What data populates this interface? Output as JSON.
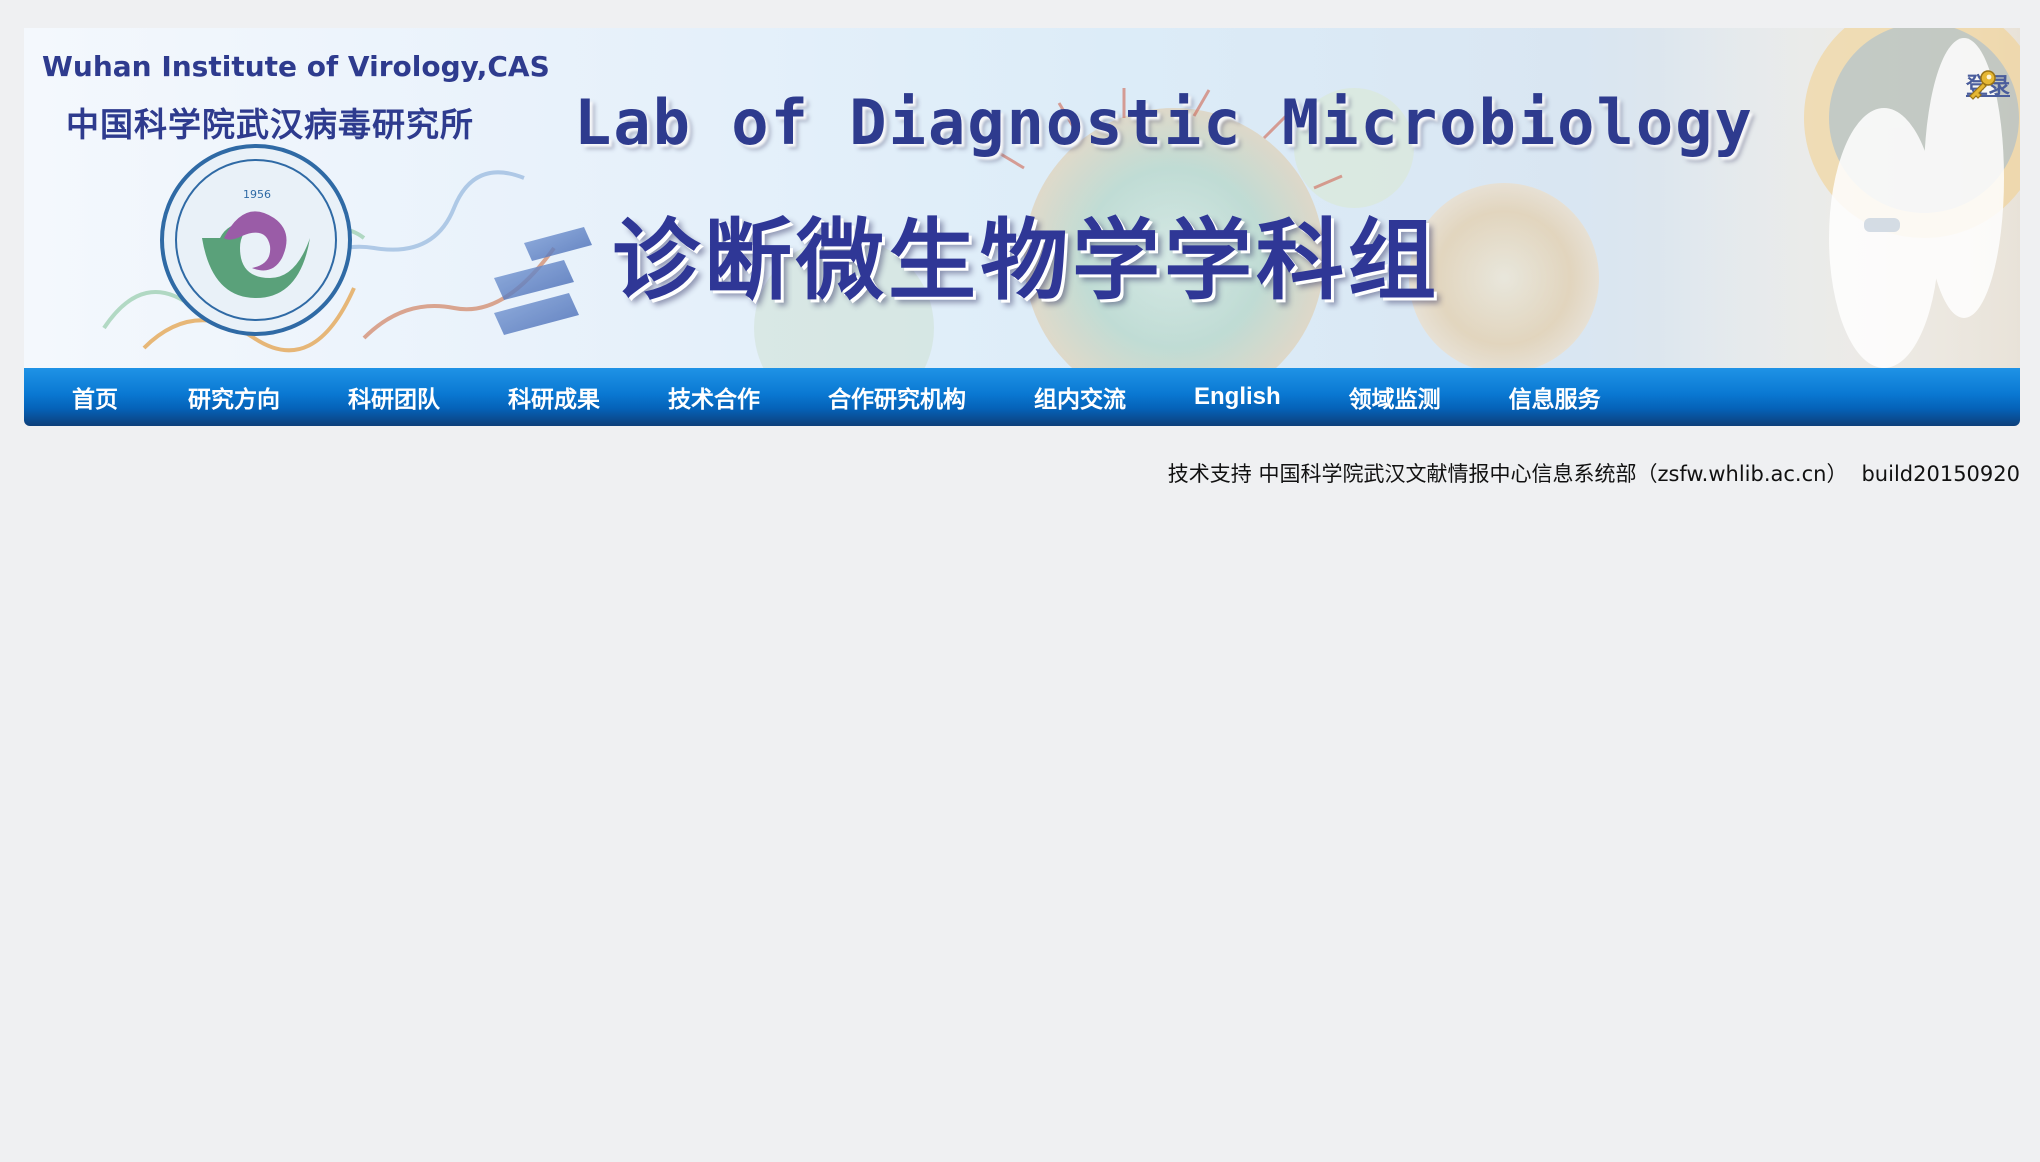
{
  "header": {
    "institute_en": "Wuhan Institute of Virology,CAS",
    "institute_cn": "中国科学院武汉病毒研究所",
    "logo_year": "1956",
    "lab_title_en": "Lab of Diagnostic Microbiology",
    "lab_title_cn": "诊断微生物学学科组",
    "login_label": "登录",
    "login_icon": "key-icon"
  },
  "nav": {
    "items": [
      {
        "label": "首页"
      },
      {
        "label": "研究方向"
      },
      {
        "label": "科研团队"
      },
      {
        "label": "科研成果"
      },
      {
        "label": "技术合作"
      },
      {
        "label": "合作研究机构"
      },
      {
        "label": "组内交流"
      },
      {
        "label": "English"
      },
      {
        "label": "领域监测"
      },
      {
        "label": "信息服务"
      }
    ]
  },
  "footer": {
    "support_text": "技术支持 中国科学院武汉文献情报中心信息系统部（zsfw.whlib.ac.cn）",
    "build": "build20150920"
  },
  "colors": {
    "nav_blue": "#0a78d2",
    "title_navy": "#2e3b8e",
    "page_bg": "#eff0f2"
  }
}
